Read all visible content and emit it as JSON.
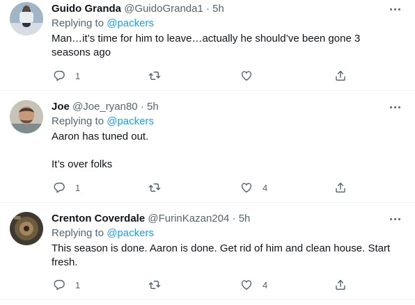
{
  "tweets": [
    {
      "name": "Guido Granda",
      "handle": "@GuidoGranda1",
      "separator": "·",
      "time": "5h",
      "replying_prefix": "Replying to",
      "replying_to": "@packers",
      "paragraphs": [
        "Man…it’s time for him to leave…actually he should’ve been gone 3 seasons ago"
      ],
      "reply_count": "1",
      "retweet_count": "",
      "like_count": ""
    },
    {
      "name": "Joe",
      "handle": "@Joe_ryan80",
      "separator": "·",
      "time": "5h",
      "replying_prefix": "Replying to",
      "replying_to": "@packers",
      "paragraphs": [
        "Aaron has tuned out.",
        "It’s over folks"
      ],
      "reply_count": "1",
      "retweet_count": "",
      "like_count": "4"
    },
    {
      "name": "Crenton Coverdale",
      "handle": "@FurinKazan204",
      "separator": "·",
      "time": "5h",
      "replying_prefix": "Replying to",
      "replying_to": "@packers",
      "paragraphs": [
        "This season is done. Aaron is done. Get rid of him and clean house. Start fresh."
      ],
      "reply_count": "1",
      "retweet_count": "",
      "like_count": "4"
    }
  ],
  "icons": {
    "reply": "reply-icon",
    "retweet": "retweet-icon",
    "like": "like-icon",
    "share": "share-icon",
    "more": "more-icon"
  },
  "colors": {
    "link": "#1d9bf0",
    "secondary_text": "#536471",
    "primary_text": "#0f1419",
    "divider": "#eff3f4"
  }
}
